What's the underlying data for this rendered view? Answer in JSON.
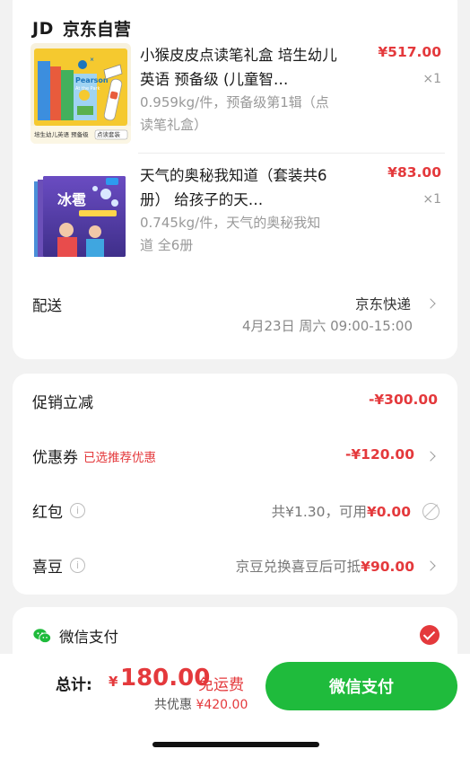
{
  "shop": {
    "logo": "JD",
    "name": "京东自营"
  },
  "products": [
    {
      "title": "小猴皮皮点读笔礼盒 培生幼儿英语 预备级 (儿童智…",
      "spec": "0.959kg/件，预备级第1辑（点读笔礼盒）",
      "price": "¥517.00",
      "qty": "×1",
      "thumb": {
        "badge": "Pearson",
        "book_title": "At the Park",
        "caption_left": "培生幼儿英语 预备级",
        "caption_right": "点读套装"
      }
    },
    {
      "title": "天气的奥秘我知道（套装共6册） 给孩子的天…",
      "spec": "0.745kg/件，天气的奥秘我知道 全6册",
      "price": "¥83.00",
      "qty": "×1",
      "thumb": {
        "book_title": "冰雹"
      }
    }
  ],
  "delivery": {
    "label": "配送",
    "carrier": "京东快递",
    "time": "4月23日 周六 09:00-15:00"
  },
  "discounts": {
    "promo": {
      "label": "促销立减",
      "value": "-¥300.00"
    },
    "coupon": {
      "label": "优惠券",
      "tag": "已选推荐优惠",
      "value": "-¥120.00"
    },
    "redpacket": {
      "label": "红包",
      "total_text": "共¥1.30，可用",
      "available": "¥0.00"
    },
    "beans": {
      "label": "喜豆",
      "text": "京豆兑换喜豆后可抵",
      "amount": "¥90.00"
    }
  },
  "payment": {
    "method": "微信支付"
  },
  "footer": {
    "total_label": "总计:",
    "currency": "¥",
    "total": "180.00",
    "free_shipping": "免运费",
    "saved_label": "共优惠",
    "saved_amount": "¥420.00",
    "pay_button": "微信支付"
  },
  "colors": {
    "accent_red": "#e4393c",
    "wechat_green": "#1fbb3c"
  }
}
